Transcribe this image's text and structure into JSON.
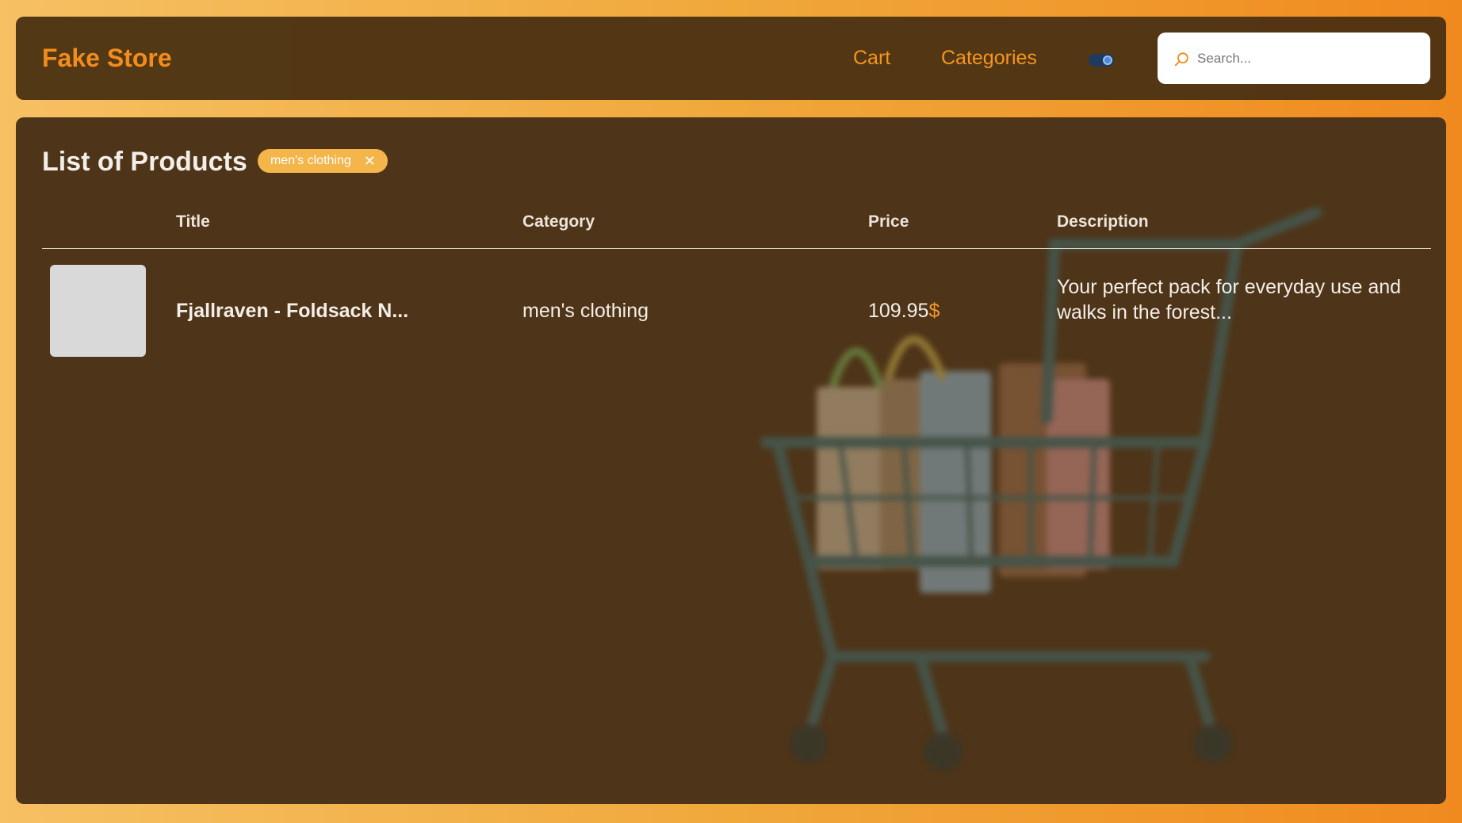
{
  "header": {
    "brand": "Fake Store",
    "nav": {
      "cart": "Cart",
      "categories": "Categories"
    },
    "theme_toggle": {
      "state": "on"
    },
    "search": {
      "placeholder": "Search...",
      "value": ""
    }
  },
  "main": {
    "title": "List of Products",
    "active_filter": {
      "label": "men's clothing",
      "close": "✕"
    },
    "table": {
      "columns": [
        "Title",
        "Category",
        "Price",
        "Description"
      ],
      "rows": [
        {
          "title": "Fjallraven - Foldsack N...",
          "category": "men's clothing",
          "price": "109.95",
          "currency": "$",
          "description": "Your perfect pack for everyday use and walks in the forest..."
        }
      ]
    }
  },
  "colors": {
    "accent": "#f28c1c",
    "chip": "#f4b54a",
    "panel": "#4e3418",
    "header": "#4a3012"
  },
  "icons": {
    "search": "search-icon",
    "close": "close-icon",
    "background": "shopping-cart-illustration"
  }
}
